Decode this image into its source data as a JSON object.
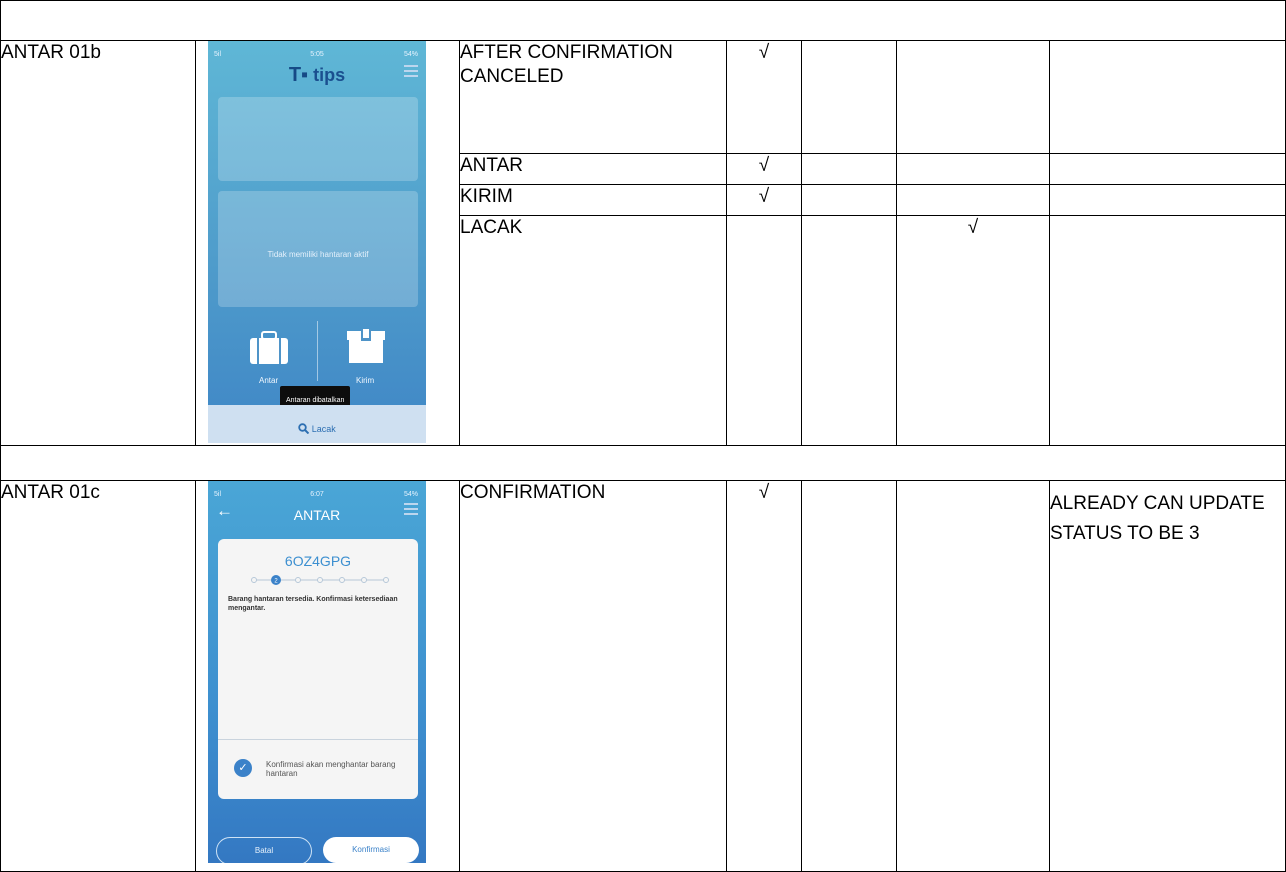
{
  "rows": [
    {
      "id": "ANTAR 01b",
      "screen": {
        "status_left": "5il",
        "status_time": "5:05",
        "status_right": "54%",
        "logo": "tips",
        "empty_message": "Tidak memiliki hantaran aktif",
        "antar_label": "Antar",
        "kirim_label": "Kirim",
        "toast": "Antaran dibatalkan",
        "lacak_label": "Lacak"
      },
      "items": [
        {
          "label": "AFTER CONFIRMATION CANCELED",
          "c1": "√",
          "c2": "",
          "c3": "",
          "note": ""
        },
        {
          "label": "ANTAR",
          "c1": "√",
          "c2": "",
          "c3": "",
          "note": ""
        },
        {
          "label": "KIRIM",
          "c1": "√",
          "c2": "",
          "c3": "",
          "note": ""
        },
        {
          "label": "LACAK",
          "c1": "",
          "c2": "",
          "c3": "√",
          "note": ""
        }
      ]
    },
    {
      "id": "ANTAR 01c",
      "screen": {
        "status_left": "5il",
        "status_time": "6:07",
        "status_right": "54%",
        "title": "ANTAR",
        "code": "6OZ4GPG",
        "step": "2",
        "description": "Barang hantaran tersedia. Konfirmasi ketersediaan mengantar.",
        "confirm_note": "Konfirmasi akan menghantar barang hantaran",
        "cancel_button": "Batal",
        "confirm_button": "Konfirmasi"
      },
      "items": [
        {
          "label": "CONFIRMATION",
          "c1": "√",
          "c2": "",
          "c3": "",
          "note": "ALREADY CAN UPDATE STATUS TO BE 3"
        }
      ]
    }
  ],
  "icons": {
    "antar": "suitcase-icon",
    "kirim": "box-icon",
    "lacak": "search-icon",
    "back": "back-arrow-icon",
    "menu": "hamburger-menu-icon",
    "check": "check-circle-icon"
  },
  "colors": {
    "accent": "#3b82c9",
    "phone_top": "#5fb7d6",
    "phone_bottom": "#3f86c6"
  }
}
